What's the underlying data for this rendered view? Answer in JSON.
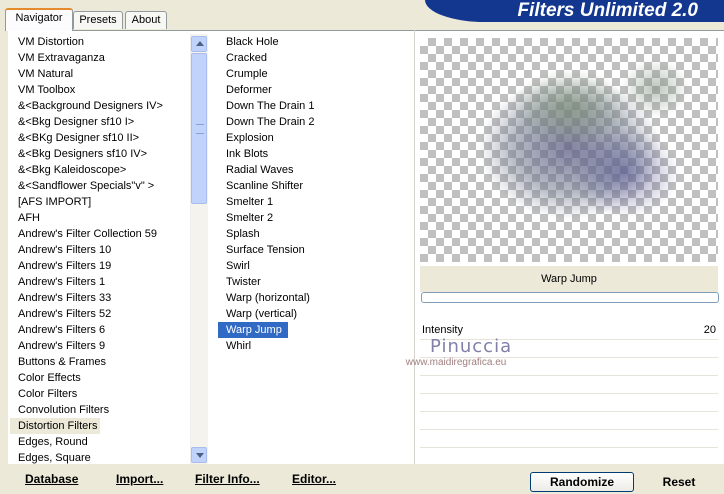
{
  "tabs": [
    {
      "label": "Navigator"
    },
    {
      "label": "Presets"
    },
    {
      "label": "About"
    }
  ],
  "header": {
    "title": "Filters Unlimited 2.0"
  },
  "categories": [
    "VM Distortion",
    "VM Extravaganza",
    "VM Natural",
    "VM Toolbox",
    "&<Background Designers IV>",
    "&<Bkg Designer sf10 I>",
    "&<BKg Designer sf10 II>",
    "&<Bkg Designers sf10 IV>",
    "&<Bkg Kaleidoscope>",
    "&<Sandflower Specials\"v\" >",
    "[AFS IMPORT]",
    "AFH",
    "Andrew's Filter Collection 59",
    "Andrew's Filters 10",
    "Andrew's Filters 19",
    "Andrew's Filters 1",
    "Andrew's Filters 33",
    "Andrew's Filters 52",
    "Andrew's Filters 6",
    "Andrew's Filters 9",
    "Buttons & Frames",
    "Color Effects",
    "Color Filters",
    "Convolution Filters",
    "Distortion Filters",
    "Edges, Round",
    "Edges, Square"
  ],
  "selected_category": "Distortion Filters",
  "filters": [
    "Black Hole",
    "Cracked",
    "Crumple",
    "Deformer",
    "Down The Drain 1",
    "Down The Drain 2",
    "Explosion",
    "Ink Blots",
    "Radial Waves",
    "Scanline Shifter",
    "Smelter 1",
    "Smelter 2",
    "Splash",
    "Surface Tension",
    "Swirl",
    "Twister",
    "Warp (horizontal)",
    "Warp (vertical)",
    "Warp Jump",
    "Whirl"
  ],
  "selected_filter": "Warp Jump",
  "preview": {
    "filter_name": "Warp Jump"
  },
  "parameters": [
    {
      "label": "Intensity",
      "value": "20"
    }
  ],
  "watermark": {
    "name": "Pinuccia",
    "url": "www.maidiregrafica.eu"
  },
  "buttons": {
    "database": "Database",
    "import": "Import...",
    "filter_info": "Filter Info...",
    "editor": "Editor...",
    "randomize": "Randomize",
    "reset": "Reset"
  },
  "colors": {
    "accent": "#13378E",
    "selection": "#316AC5",
    "tab_highlight": "#E68B2C"
  }
}
